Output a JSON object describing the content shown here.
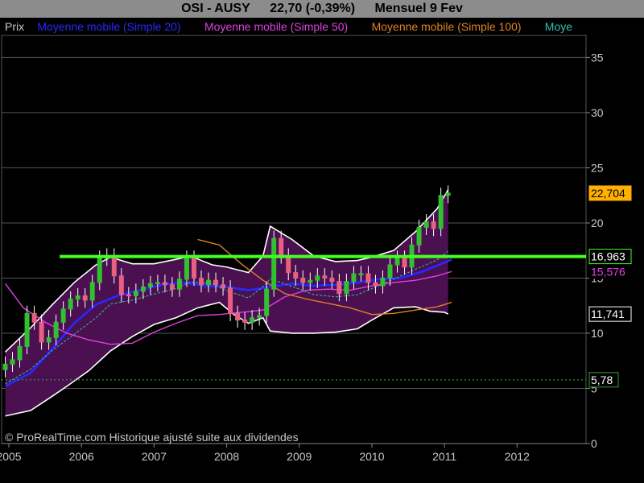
{
  "header": {
    "symbol": "OSI - AUSY",
    "quote": "22,70 (-0,39%)",
    "period": "Mensuel  9 Fev"
  },
  "legend": {
    "items": [
      {
        "label": "Prix",
        "color": "#c8c8c8"
      },
      {
        "label": "Moyenne mobile (Simple 20)",
        "color": "#2828ff"
      },
      {
        "label": "Moyenne mobile (Simple 50)",
        "color": "#e040e0"
      },
      {
        "label": "Moyenne mobile (Simple 100)",
        "color": "#e08020"
      },
      {
        "label": "Moye",
        "color": "#30c0b0"
      }
    ]
  },
  "footer": {
    "copyright": "© ProRealTime.com Historique ajusté suite aux dividendes"
  },
  "colors": {
    "background": "#000000",
    "band_fill": "#4a1050",
    "band_edge": "#ffffff",
    "candle_up": "#30c030",
    "candle_down": "#e86080",
    "resistance": "#44ff22",
    "support_dotted": "#30a030",
    "grid": "#555555"
  },
  "chart_data": {
    "type": "candlestick",
    "title": "OSI - AUSY",
    "ylim": [
      0,
      37
    ],
    "xlim": [
      2004.9,
      2012.95
    ],
    "yticks": [
      0,
      5,
      10,
      15,
      20,
      25,
      30,
      35
    ],
    "xticks": [
      "2005",
      "2006",
      "2007",
      "2008",
      "2009",
      "2010",
      "2011",
      "2012"
    ],
    "close_series": [
      [
        2004.95,
        7.2
      ],
      [
        2005.05,
        7.6
      ],
      [
        2005.15,
        8.8
      ],
      [
        2005.25,
        11.8
      ],
      [
        2005.35,
        11.0
      ],
      [
        2005.45,
        9.2
      ],
      [
        2005.55,
        9.6
      ],
      [
        2005.65,
        11.0
      ],
      [
        2005.75,
        12.2
      ],
      [
        2005.85,
        13.1
      ],
      [
        2005.95,
        13.4
      ],
      [
        2006.05,
        13.0
      ],
      [
        2006.15,
        14.6
      ],
      [
        2006.25,
        16.8
      ],
      [
        2006.35,
        17.0
      ],
      [
        2006.45,
        15.2
      ],
      [
        2006.55,
        13.5
      ],
      [
        2006.65,
        13.4
      ],
      [
        2006.75,
        13.8
      ],
      [
        2006.85,
        14.2
      ],
      [
        2006.95,
        14.5
      ],
      [
        2007.05,
        14.6
      ],
      [
        2007.15,
        14.4
      ],
      [
        2007.25,
        14.0
      ],
      [
        2007.35,
        14.9
      ],
      [
        2007.45,
        16.8
      ],
      [
        2007.55,
        15.0
      ],
      [
        2007.65,
        14.4
      ],
      [
        2007.75,
        14.8
      ],
      [
        2007.85,
        14.4
      ],
      [
        2007.95,
        14.1
      ],
      [
        2008.05,
        11.8
      ],
      [
        2008.15,
        11.2
      ],
      [
        2008.25,
        11.0
      ],
      [
        2008.35,
        11.4
      ],
      [
        2008.45,
        11.6
      ],
      [
        2008.55,
        14.0
      ],
      [
        2008.65,
        18.6
      ],
      [
        2008.75,
        17.0
      ],
      [
        2008.85,
        15.5
      ],
      [
        2008.95,
        15.0
      ],
      [
        2009.05,
        14.6
      ],
      [
        2009.15,
        14.8
      ],
      [
        2009.25,
        15.2
      ],
      [
        2009.35,
        15.0
      ],
      [
        2009.45,
        14.7
      ],
      [
        2009.55,
        13.6
      ],
      [
        2009.65,
        14.7
      ],
      [
        2009.75,
        15.4
      ],
      [
        2009.85,
        15.4
      ],
      [
        2009.95,
        14.6
      ],
      [
        2010.05,
        14.3
      ],
      [
        2010.15,
        15.0
      ],
      [
        2010.25,
        16.2
      ],
      [
        2010.35,
        16.8
      ],
      [
        2010.45,
        16.0
      ],
      [
        2010.55,
        18.0
      ],
      [
        2010.65,
        19.6
      ],
      [
        2010.75,
        20.1
      ],
      [
        2010.85,
        19.5
      ],
      [
        2010.95,
        22.5
      ],
      [
        2011.05,
        22.7
      ]
    ],
    "moving_averages": [
      {
        "name": "Moyenne mobile (Simple 20)",
        "values": [
          [
            2004.95,
            5.2
          ],
          [
            2005.3,
            6.4
          ],
          [
            2005.6,
            8.6
          ],
          [
            2005.9,
            10.9
          ],
          [
            2006.2,
            12.6
          ],
          [
            2006.5,
            13.4
          ],
          [
            2006.8,
            13.9
          ],
          [
            2007.1,
            14.4
          ],
          [
            2007.4,
            14.6
          ],
          [
            2007.7,
            14.3
          ],
          [
            2008.0,
            14.2
          ],
          [
            2008.3,
            13.9
          ],
          [
            2008.6,
            14.2
          ],
          [
            2008.9,
            14.5
          ],
          [
            2009.2,
            14.3
          ],
          [
            2009.5,
            14.4
          ],
          [
            2009.8,
            14.6
          ],
          [
            2010.1,
            14.9
          ],
          [
            2010.4,
            15.0
          ],
          [
            2010.7,
            15.6
          ],
          [
            2011.0,
            16.4
          ],
          [
            2011.1,
            16.7
          ]
        ]
      },
      {
        "name": "Moyenne mobile (Simple 50)",
        "values": [
          [
            2004.95,
            14.5
          ],
          [
            2005.2,
            12.3
          ],
          [
            2005.5,
            11.0
          ],
          [
            2005.8,
            10.0
          ],
          [
            2006.1,
            9.4
          ],
          [
            2006.4,
            9.0
          ],
          [
            2006.7,
            9.1
          ],
          [
            2007.0,
            10.1
          ],
          [
            2007.3,
            10.9
          ],
          [
            2007.6,
            11.6
          ],
          [
            2007.9,
            11.7
          ],
          [
            2008.2,
            11.9
          ],
          [
            2008.5,
            12.1
          ],
          [
            2008.8,
            13.3
          ],
          [
            2009.1,
            13.9
          ],
          [
            2009.4,
            14.0
          ],
          [
            2009.7,
            13.9
          ],
          [
            2010.0,
            14.3
          ],
          [
            2010.3,
            14.6
          ],
          [
            2010.6,
            14.8
          ],
          [
            2010.9,
            15.2
          ],
          [
            2011.1,
            15.6
          ]
        ]
      },
      {
        "name": "Moyenne mobile (Simple 100)",
        "values": [
          [
            2007.6,
            18.5
          ],
          [
            2007.9,
            18.0
          ],
          [
            2008.2,
            16.3
          ],
          [
            2008.5,
            14.8
          ],
          [
            2008.8,
            13.6
          ],
          [
            2009.1,
            13.1
          ],
          [
            2009.4,
            12.7
          ],
          [
            2009.7,
            12.3
          ],
          [
            2010.0,
            11.7
          ],
          [
            2010.3,
            11.8
          ],
          [
            2010.6,
            12.1
          ],
          [
            2010.9,
            12.4
          ],
          [
            2011.1,
            12.8
          ]
        ]
      }
    ],
    "bands": {
      "upper": [
        [
          2004.95,
          8.3
        ],
        [
          2005.3,
          10.5
        ],
        [
          2005.6,
          12.6
        ],
        [
          2005.9,
          14.6
        ],
        [
          2006.2,
          16.2
        ],
        [
          2006.4,
          16.9
        ],
        [
          2006.7,
          16.3
        ],
        [
          2007.0,
          16.3
        ],
        [
          2007.3,
          16.7
        ],
        [
          2007.5,
          17.0
        ],
        [
          2007.8,
          16.2
        ],
        [
          2008.0,
          16.0
        ],
        [
          2008.3,
          15.5
        ],
        [
          2008.5,
          17.0
        ],
        [
          2008.6,
          19.7
        ],
        [
          2008.9,
          18.5
        ],
        [
          2009.2,
          17.0
        ],
        [
          2009.5,
          16.5
        ],
        [
          2009.8,
          16.6
        ],
        [
          2010.0,
          16.9
        ],
        [
          2010.3,
          17.5
        ],
        [
          2010.6,
          19.2
        ],
        [
          2010.9,
          21.3
        ],
        [
          2011.05,
          23.0
        ]
      ],
      "lower": [
        [
          2004.95,
          2.5
        ],
        [
          2005.3,
          3.0
        ],
        [
          2005.6,
          4.3
        ],
        [
          2005.8,
          5.2
        ],
        [
          2006.1,
          6.6
        ],
        [
          2006.4,
          8.4
        ],
        [
          2006.7,
          9.7
        ],
        [
          2007.0,
          10.8
        ],
        [
          2007.3,
          11.4
        ],
        [
          2007.6,
          12.3
        ],
        [
          2007.9,
          12.8
        ],
        [
          2008.1,
          11.7
        ],
        [
          2008.3,
          10.9
        ],
        [
          2008.5,
          11.4
        ],
        [
          2008.6,
          10.2
        ],
        [
          2008.9,
          10.0
        ],
        [
          2009.2,
          10.0
        ],
        [
          2009.5,
          10.1
        ],
        [
          2009.8,
          10.4
        ],
        [
          2010.0,
          11.2
        ],
        [
          2010.3,
          12.3
        ],
        [
          2010.6,
          12.4
        ],
        [
          2010.8,
          12.0
        ],
        [
          2011.0,
          11.9
        ],
        [
          2011.05,
          11.74
        ]
      ]
    },
    "levels": [
      {
        "label": "22,704",
        "value": 22.7,
        "style": "last"
      },
      {
        "label": "16,963",
        "value": 16.96,
        "style": "resistance"
      },
      {
        "label": "15,576",
        "value": 15.58,
        "style": "ma50"
      },
      {
        "label": "11,741",
        "value": 11.74,
        "style": "band"
      },
      {
        "label": "5,78",
        "value": 5.78,
        "style": "support"
      }
    ],
    "resistance_line": {
      "value": 16.96,
      "x_start": 2005.7,
      "x_end": 2012.95
    },
    "support_line": {
      "value": 5.78
    }
  }
}
